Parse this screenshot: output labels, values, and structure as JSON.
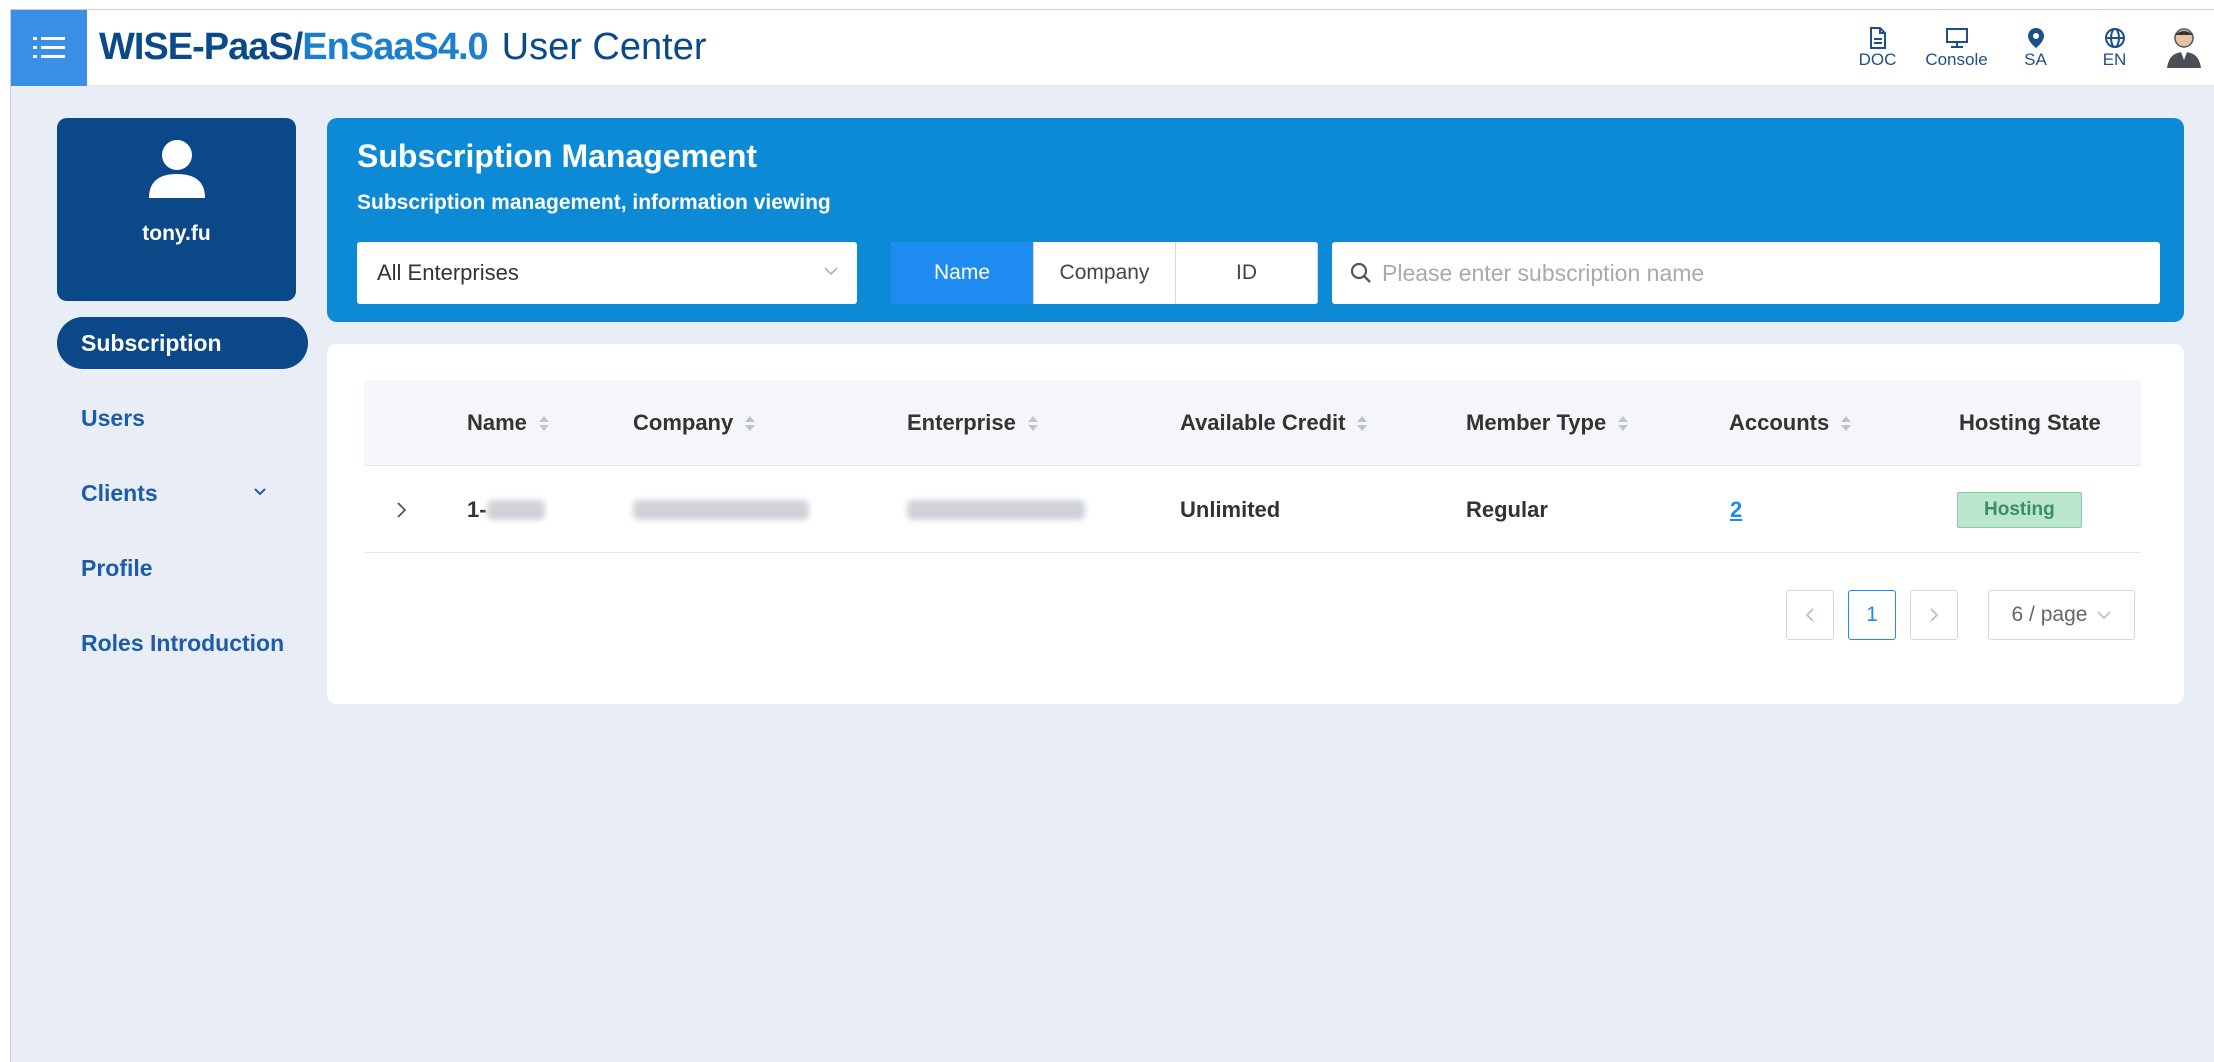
{
  "header": {
    "brand_part1": "WISE-PaaS/",
    "brand_part2": "EnSaaS4.0",
    "app_title": "User Center",
    "actions": [
      {
        "label": "DOC",
        "icon": "document-icon"
      },
      {
        "label": "Console",
        "icon": "monitor-icon"
      },
      {
        "label": "SA",
        "icon": "location-pin-icon"
      },
      {
        "label": "EN",
        "icon": "globe-icon"
      }
    ]
  },
  "sidebar": {
    "username": "tony.fu",
    "items": [
      {
        "label": "Subscription",
        "active": true
      },
      {
        "label": "Users"
      },
      {
        "label": "Clients",
        "has_submenu": true
      },
      {
        "label": "Profile"
      },
      {
        "label": "Roles Introduction"
      }
    ]
  },
  "page": {
    "title": "Subscription Management",
    "subtitle": "Subscription management, information viewing",
    "enterprise_select": "All Enterprises",
    "search_modes": [
      "Name",
      "Company",
      "ID"
    ],
    "active_search_mode": "Name",
    "search_placeholder": "Please enter subscription name"
  },
  "table": {
    "columns": [
      "Name",
      "Company",
      "Enterprise",
      "Available Credit",
      "Member Type",
      "Accounts",
      "Hosting State"
    ],
    "rows": [
      {
        "name_prefix": "1-",
        "available_credit": "Unlimited",
        "member_type": "Regular",
        "accounts": "2",
        "hosting_state": "Hosting"
      }
    ]
  },
  "pagination": {
    "current_page": "1",
    "page_size": "6 / page"
  },
  "colors": {
    "brand_dark": "#0b4888",
    "brand_blue": "#0c8ad6",
    "accent": "#1e8bf0",
    "status_hosting": "#b9e6cd"
  }
}
